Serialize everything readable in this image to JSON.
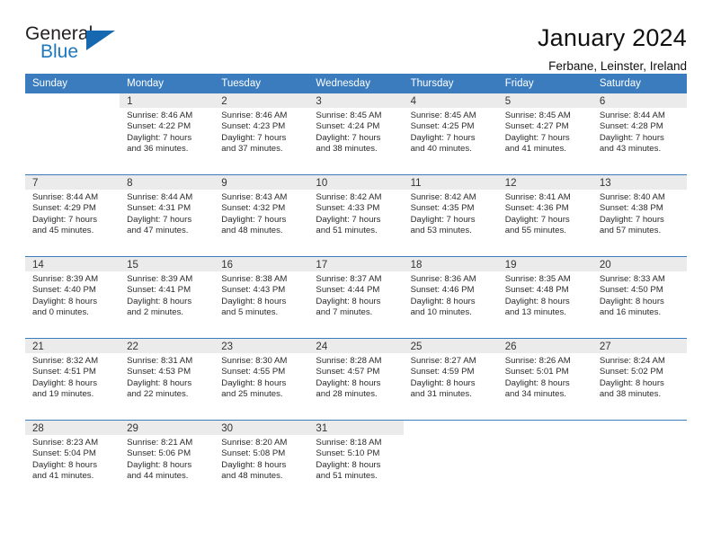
{
  "brand": {
    "name_top": "General",
    "name_bottom": "Blue",
    "triangle_icon": "triangle-icon",
    "color_top": "#231f20",
    "color_bottom": "#1f77bd"
  },
  "header": {
    "title": "January 2024",
    "subtitle": "Ferbane, Leinster, Ireland"
  },
  "calendar": {
    "accent_color": "#3a7cbe",
    "daynum_background": "#ebebeb",
    "weekday_headers": [
      "Sunday",
      "Monday",
      "Tuesday",
      "Wednesday",
      "Thursday",
      "Friday",
      "Saturday"
    ],
    "weeks": [
      [
        {
          "day": "",
          "lines": []
        },
        {
          "day": "1",
          "lines": [
            "Sunrise: 8:46 AM",
            "Sunset: 4:22 PM",
            "Daylight: 7 hours",
            "and 36 minutes."
          ]
        },
        {
          "day": "2",
          "lines": [
            "Sunrise: 8:46 AM",
            "Sunset: 4:23 PM",
            "Daylight: 7 hours",
            "and 37 minutes."
          ]
        },
        {
          "day": "3",
          "lines": [
            "Sunrise: 8:45 AM",
            "Sunset: 4:24 PM",
            "Daylight: 7 hours",
            "and 38 minutes."
          ]
        },
        {
          "day": "4",
          "lines": [
            "Sunrise: 8:45 AM",
            "Sunset: 4:25 PM",
            "Daylight: 7 hours",
            "and 40 minutes."
          ]
        },
        {
          "day": "5",
          "lines": [
            "Sunrise: 8:45 AM",
            "Sunset: 4:27 PM",
            "Daylight: 7 hours",
            "and 41 minutes."
          ]
        },
        {
          "day": "6",
          "lines": [
            "Sunrise: 8:44 AM",
            "Sunset: 4:28 PM",
            "Daylight: 7 hours",
            "and 43 minutes."
          ]
        }
      ],
      [
        {
          "day": "7",
          "lines": [
            "Sunrise: 8:44 AM",
            "Sunset: 4:29 PM",
            "Daylight: 7 hours",
            "and 45 minutes."
          ]
        },
        {
          "day": "8",
          "lines": [
            "Sunrise: 8:44 AM",
            "Sunset: 4:31 PM",
            "Daylight: 7 hours",
            "and 47 minutes."
          ]
        },
        {
          "day": "9",
          "lines": [
            "Sunrise: 8:43 AM",
            "Sunset: 4:32 PM",
            "Daylight: 7 hours",
            "and 48 minutes."
          ]
        },
        {
          "day": "10",
          "lines": [
            "Sunrise: 8:42 AM",
            "Sunset: 4:33 PM",
            "Daylight: 7 hours",
            "and 51 minutes."
          ]
        },
        {
          "day": "11",
          "lines": [
            "Sunrise: 8:42 AM",
            "Sunset: 4:35 PM",
            "Daylight: 7 hours",
            "and 53 minutes."
          ]
        },
        {
          "day": "12",
          "lines": [
            "Sunrise: 8:41 AM",
            "Sunset: 4:36 PM",
            "Daylight: 7 hours",
            "and 55 minutes."
          ]
        },
        {
          "day": "13",
          "lines": [
            "Sunrise: 8:40 AM",
            "Sunset: 4:38 PM",
            "Daylight: 7 hours",
            "and 57 minutes."
          ]
        }
      ],
      [
        {
          "day": "14",
          "lines": [
            "Sunrise: 8:39 AM",
            "Sunset: 4:40 PM",
            "Daylight: 8 hours",
            "and 0 minutes."
          ]
        },
        {
          "day": "15",
          "lines": [
            "Sunrise: 8:39 AM",
            "Sunset: 4:41 PM",
            "Daylight: 8 hours",
            "and 2 minutes."
          ]
        },
        {
          "day": "16",
          "lines": [
            "Sunrise: 8:38 AM",
            "Sunset: 4:43 PM",
            "Daylight: 8 hours",
            "and 5 minutes."
          ]
        },
        {
          "day": "17",
          "lines": [
            "Sunrise: 8:37 AM",
            "Sunset: 4:44 PM",
            "Daylight: 8 hours",
            "and 7 minutes."
          ]
        },
        {
          "day": "18",
          "lines": [
            "Sunrise: 8:36 AM",
            "Sunset: 4:46 PM",
            "Daylight: 8 hours",
            "and 10 minutes."
          ]
        },
        {
          "day": "19",
          "lines": [
            "Sunrise: 8:35 AM",
            "Sunset: 4:48 PM",
            "Daylight: 8 hours",
            "and 13 minutes."
          ]
        },
        {
          "day": "20",
          "lines": [
            "Sunrise: 8:33 AM",
            "Sunset: 4:50 PM",
            "Daylight: 8 hours",
            "and 16 minutes."
          ]
        }
      ],
      [
        {
          "day": "21",
          "lines": [
            "Sunrise: 8:32 AM",
            "Sunset: 4:51 PM",
            "Daylight: 8 hours",
            "and 19 minutes."
          ]
        },
        {
          "day": "22",
          "lines": [
            "Sunrise: 8:31 AM",
            "Sunset: 4:53 PM",
            "Daylight: 8 hours",
            "and 22 minutes."
          ]
        },
        {
          "day": "23",
          "lines": [
            "Sunrise: 8:30 AM",
            "Sunset: 4:55 PM",
            "Daylight: 8 hours",
            "and 25 minutes."
          ]
        },
        {
          "day": "24",
          "lines": [
            "Sunrise: 8:28 AM",
            "Sunset: 4:57 PM",
            "Daylight: 8 hours",
            "and 28 minutes."
          ]
        },
        {
          "day": "25",
          "lines": [
            "Sunrise: 8:27 AM",
            "Sunset: 4:59 PM",
            "Daylight: 8 hours",
            "and 31 minutes."
          ]
        },
        {
          "day": "26",
          "lines": [
            "Sunrise: 8:26 AM",
            "Sunset: 5:01 PM",
            "Daylight: 8 hours",
            "and 34 minutes."
          ]
        },
        {
          "day": "27",
          "lines": [
            "Sunrise: 8:24 AM",
            "Sunset: 5:02 PM",
            "Daylight: 8 hours",
            "and 38 minutes."
          ]
        }
      ],
      [
        {
          "day": "28",
          "lines": [
            "Sunrise: 8:23 AM",
            "Sunset: 5:04 PM",
            "Daylight: 8 hours",
            "and 41 minutes."
          ]
        },
        {
          "day": "29",
          "lines": [
            "Sunrise: 8:21 AM",
            "Sunset: 5:06 PM",
            "Daylight: 8 hours",
            "and 44 minutes."
          ]
        },
        {
          "day": "30",
          "lines": [
            "Sunrise: 8:20 AM",
            "Sunset: 5:08 PM",
            "Daylight: 8 hours",
            "and 48 minutes."
          ]
        },
        {
          "day": "31",
          "lines": [
            "Sunrise: 8:18 AM",
            "Sunset: 5:10 PM",
            "Daylight: 8 hours",
            "and 51 minutes."
          ]
        },
        {
          "day": "",
          "lines": []
        },
        {
          "day": "",
          "lines": []
        },
        {
          "day": "",
          "lines": []
        }
      ]
    ]
  }
}
